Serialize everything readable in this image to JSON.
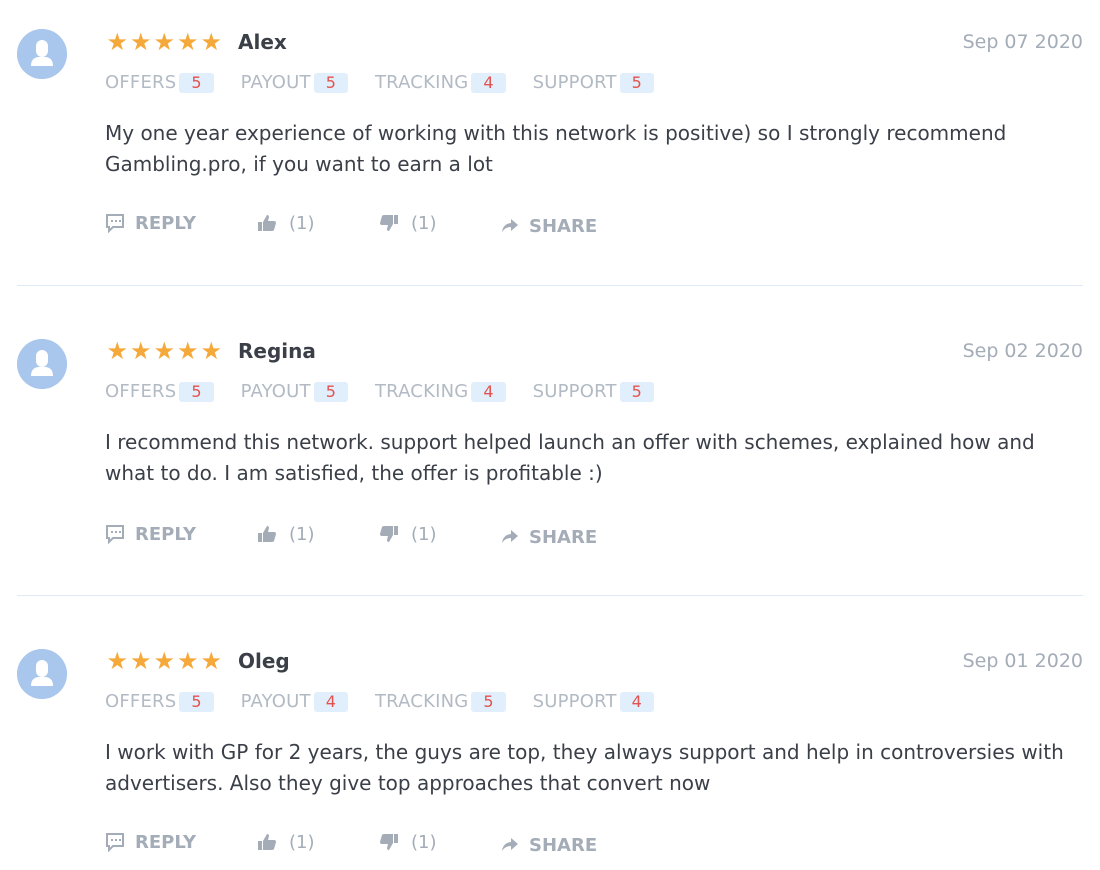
{
  "reviews": [
    {
      "author": "Alex",
      "date": "Sep 07 2020",
      "stars": [
        "★",
        "★",
        "★",
        "★",
        "★"
      ],
      "ratings": [
        {
          "label": "OFFERS",
          "value": "5"
        },
        {
          "label": "PAYOUT",
          "value": "5"
        },
        {
          "label": "TRACKING",
          "value": "4"
        },
        {
          "label": "SUPPORT",
          "value": "5"
        }
      ],
      "text": "My one year experience of working with this network is positive) so I strongly recommend Gambling.pro, if you want to earn a lot",
      "actions": {
        "reply": "REPLY",
        "likes": "(1)",
        "dislikes": "(1)",
        "share": "SHARE"
      }
    },
    {
      "author": "Regina",
      "date": "Sep 02 2020",
      "stars": [
        "★",
        "★",
        "★",
        "★",
        "★"
      ],
      "ratings": [
        {
          "label": "OFFERS",
          "value": "5"
        },
        {
          "label": "PAYOUT",
          "value": "5"
        },
        {
          "label": "TRACKING",
          "value": "4"
        },
        {
          "label": "SUPPORT",
          "value": "5"
        }
      ],
      "text": "I recommend this network. support helped launch an offer with schemes, explained how and what to do. I am satisfied, the offer is profitable :)",
      "actions": {
        "reply": "REPLY",
        "likes": "(1)",
        "dislikes": "(1)",
        "share": "SHARE"
      }
    },
    {
      "author": "Oleg",
      "date": "Sep 01 2020",
      "stars": [
        "★",
        "★",
        "★",
        "★",
        "★"
      ],
      "ratings": [
        {
          "label": "OFFERS",
          "value": "5"
        },
        {
          "label": "PAYOUT",
          "value": "4"
        },
        {
          "label": "TRACKING",
          "value": "5"
        },
        {
          "label": "SUPPORT",
          "value": "4"
        }
      ],
      "text": "I work with GP for 2 years, the guys are top, they always support and help in controversies with advertisers. Also they give top approaches that convert now",
      "actions": {
        "reply": "REPLY",
        "likes": "(1)",
        "dislikes": "(1)",
        "share": "SHARE"
      }
    }
  ],
  "colors": {
    "star": "#f6a93b",
    "rating_badge_bg": "#e1effc",
    "rating_badge_text": "#e4524f",
    "avatar_bg": "#a9c6ec",
    "muted_text": "#a3acb7",
    "divider": "#dfeaf6"
  },
  "icons": {
    "avatar": "user-avatar-icon",
    "reply": "comment-icon",
    "like": "thumbs-up-icon",
    "dislike": "thumbs-down-icon",
    "share": "share-arrow-icon"
  }
}
